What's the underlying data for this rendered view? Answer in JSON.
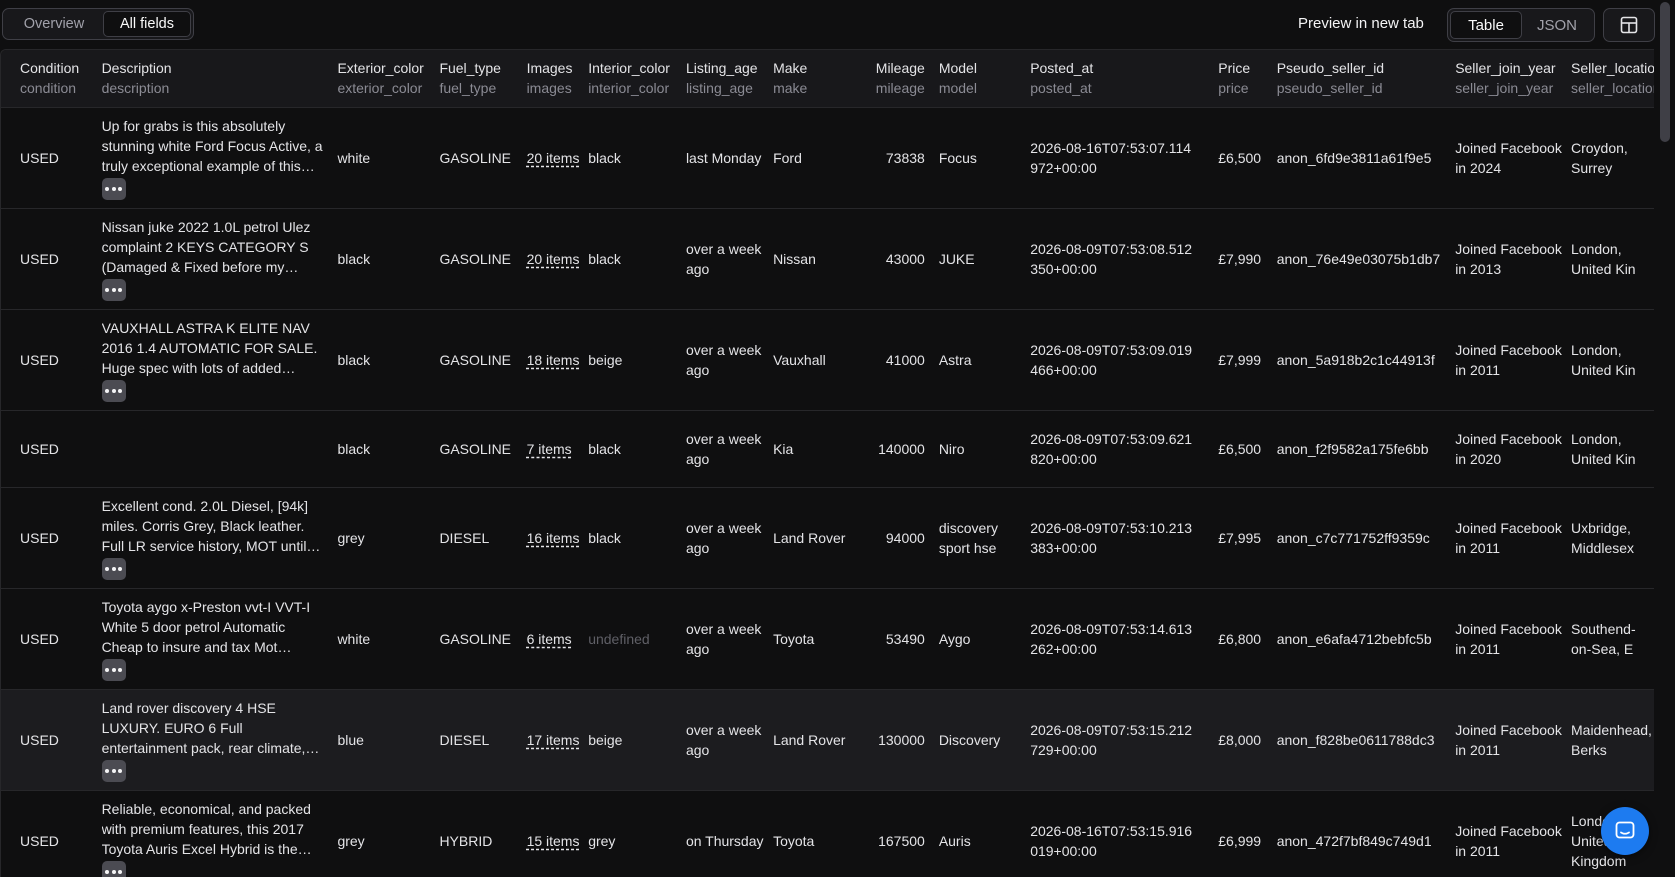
{
  "view_tabs": {
    "overview": "Overview",
    "all_fields": "All fields",
    "active": "All fields"
  },
  "preview_label": "Preview in new tab",
  "format_tabs": {
    "table": "Table",
    "json": "JSON",
    "active": "Table"
  },
  "icons": {
    "layout": "layout-panel-icon",
    "more": "more-dots-icon",
    "chat": "chat-icon"
  },
  "colors": {
    "accent": "#1d7bf0",
    "background": "#0f0f10",
    "header_bg": "#18181b",
    "undefined_text": "#5f5f66"
  },
  "columns": [
    {
      "label": "Condition",
      "key": "condition"
    },
    {
      "label": "Description",
      "key": "description"
    },
    {
      "label": "Exterior_color",
      "key": "exterior_color"
    },
    {
      "label": "Fuel_type",
      "key": "fuel_type"
    },
    {
      "label": "Images",
      "key": "images"
    },
    {
      "label": "Interior_color",
      "key": "interior_color"
    },
    {
      "label": "Listing_age",
      "key": "listing_age"
    },
    {
      "label": "Make",
      "key": "make"
    },
    {
      "label": "Mileage",
      "key": "mileage"
    },
    {
      "label": "Model",
      "key": "model"
    },
    {
      "label": "Posted_at",
      "key": "posted_at"
    },
    {
      "label": "Price",
      "key": "price"
    },
    {
      "label": "Pseudo_seller_id",
      "key": "pseudo_seller_id"
    },
    {
      "label": "Seller_join_year",
      "key": "seller_join_year"
    },
    {
      "label": "Seller_location",
      "key": "seller_location"
    }
  ],
  "rows": [
    {
      "condition": "USED",
      "description": "Up for grabs is this absolutely stunning white Ford Focus Active, a truly exceptional example of this…",
      "exterior_color": "white",
      "fuel_type": "GASOLINE",
      "images": "20 items",
      "interior_color": "black",
      "listing_age": "last Monday",
      "make": "Ford",
      "mileage": "73838",
      "model": "Focus",
      "posted_at": "2026-08-16T07:53:07.114972+00:00",
      "price": "£6,500",
      "pseudo_seller_id": "anon_6fd9e3811a61f9e5",
      "seller_join_year": "Joined Facebook in 2024",
      "seller_location": "Croydon, Surrey"
    },
    {
      "condition": "USED",
      "description": "Nissan juke 2022 1.0L petrol Ulez complaint 2 KEYS CATEGORY S (Damaged & Fixed before my…",
      "exterior_color": "black",
      "fuel_type": "GASOLINE",
      "images": "20 items",
      "interior_color": "black",
      "listing_age": "over a week ago",
      "make": "Nissan",
      "mileage": "43000",
      "model": "JUKE",
      "posted_at": "2026-08-09T07:53:08.512350+00:00",
      "price": "£7,990",
      "pseudo_seller_id": "anon_76e49e03075b1db7",
      "seller_join_year": "Joined Facebook in 2013",
      "seller_location": "London, United Kin"
    },
    {
      "condition": "USED",
      "description": "VAUXHALL ASTRA K ELITE NAV 2016 1.4 AUTOMATIC FOR SALE. Huge spec with lots of added…",
      "exterior_color": "black",
      "fuel_type": "GASOLINE",
      "images": "18 items",
      "interior_color": "beige",
      "listing_age": "over a week ago",
      "make": "Vauxhall",
      "mileage": "41000",
      "model": "Astra",
      "posted_at": "2026-08-09T07:53:09.019466+00:00",
      "price": "£7,999",
      "pseudo_seller_id": "anon_5a918b2c1c44913f",
      "seller_join_year": "Joined Facebook in 2011",
      "seller_location": "London, United Kin"
    },
    {
      "condition": "USED",
      "description": "",
      "exterior_color": "black",
      "fuel_type": "GASOLINE",
      "images": "7 items",
      "interior_color": "black",
      "listing_age": "over a week ago",
      "make": "Kia",
      "mileage": "140000",
      "model": "Niro",
      "posted_at": "2026-08-09T07:53:09.621820+00:00",
      "price": "£6,500",
      "pseudo_seller_id": "anon_f2f9582a175fe6bb",
      "seller_join_year": "Joined Facebook in 2020",
      "seller_location": "London, United Kin"
    },
    {
      "condition": "USED",
      "description": "Excellent cond. 2.0L Diesel, [94k] miles. Corris Grey, Black leather. Full LR service history, MOT until…",
      "exterior_color": "grey",
      "fuel_type": "DIESEL",
      "images": "16 items",
      "interior_color": "black",
      "listing_age": "over a week ago",
      "make": "Land Rover",
      "mileage": "94000",
      "model": "discovery sport hse",
      "posted_at": "2026-08-09T07:53:10.213383+00:00",
      "price": "£7,995",
      "pseudo_seller_id": "anon_c7c771752ff9359c",
      "seller_join_year": "Joined Facebook in 2011",
      "seller_location": "Uxbridge, Middlesex"
    },
    {
      "condition": "USED",
      "description": "Toyota aygo x-Preston vvt-I VVT-I White 5 door petrol Automatic Cheap to insure and tax Mot…",
      "exterior_color": "white",
      "fuel_type": "GASOLINE",
      "images": "6 items",
      "interior_color": "undefined",
      "listing_age": "over a week ago",
      "make": "Toyota",
      "mileage": "53490",
      "model": "Aygo",
      "posted_at": "2026-08-09T07:53:14.613262+00:00",
      "price": "£6,800",
      "pseudo_seller_id": "anon_e6afa4712bebfc5b",
      "seller_join_year": "Joined Facebook in 2011",
      "seller_location": "Southend-on-Sea, E"
    },
    {
      "condition": "USED",
      "description": "Land rover discovery 4 HSE LUXURY. EURO 6 Full entertainment pack, rear climate,…",
      "exterior_color": "blue",
      "fuel_type": "DIESEL",
      "images": "17 items",
      "interior_color": "beige",
      "listing_age": "over a week ago",
      "make": "Land Rover",
      "mileage": "130000",
      "model": "Discovery",
      "posted_at": "2026-08-09T07:53:15.212729+00:00",
      "price": "£8,000",
      "pseudo_seller_id": "anon_f828be0611788dc3",
      "seller_join_year": "Joined Facebook in 2011",
      "seller_location": "Maidenhead, Berks"
    },
    {
      "condition": "USED",
      "description": "Reliable, economical, and packed with premium features, this 2017 Toyota Auris Excel Hybrid is the…",
      "exterior_color": "grey",
      "fuel_type": "HYBRID",
      "images": "15 items",
      "interior_color": "grey",
      "listing_age": "on Thursday",
      "make": "Toyota",
      "mileage": "167500",
      "model": "Auris",
      "posted_at": "2026-08-16T07:53:15.916019+00:00",
      "price": "£6,999",
      "pseudo_seller_id": "anon_472f7bf849c749d1",
      "seller_join_year": "Joined Facebook in 2011",
      "seller_location": "London, United Kingdom"
    }
  ]
}
